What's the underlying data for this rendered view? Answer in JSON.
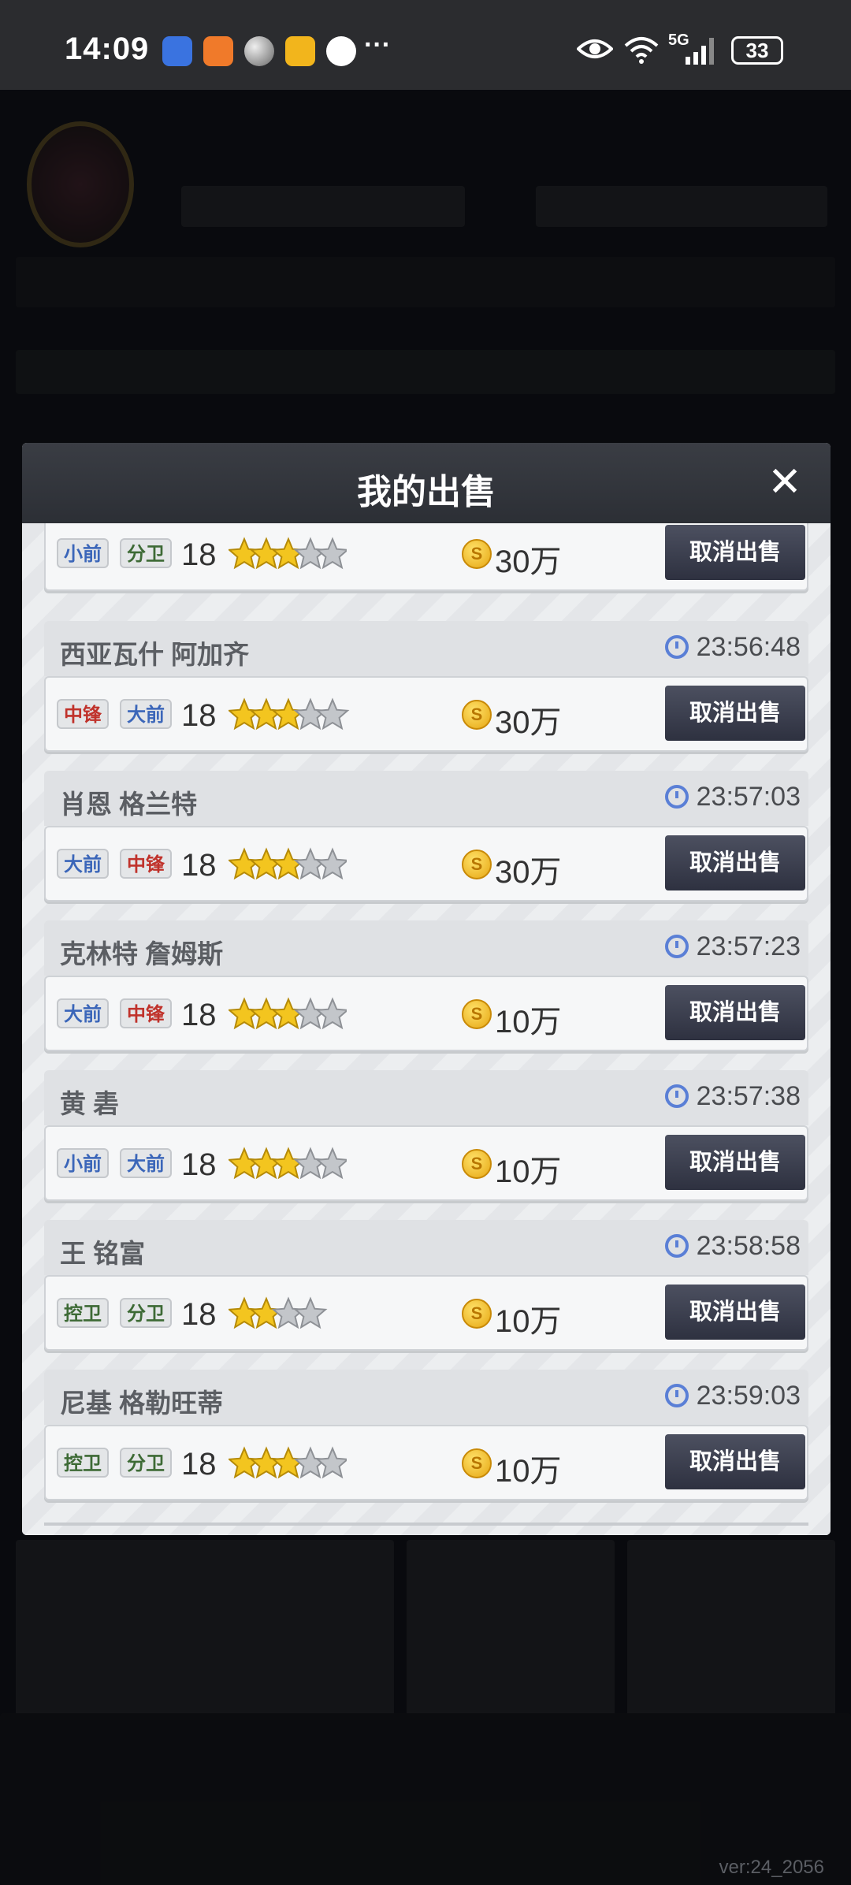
{
  "status_bar": {
    "time": "14:09",
    "more": "···",
    "network": "5G",
    "battery": "33"
  },
  "modal": {
    "title": "我的出售",
    "close_label": "✕"
  },
  "listings": [
    {
      "name": "",
      "timer": "",
      "tags": [
        {
          "label": "小前",
          "color": "blue"
        },
        {
          "label": "分卫",
          "color": "green"
        }
      ],
      "level": "18",
      "stars": 3,
      "half_star": false,
      "price": "30万",
      "cancel_label": "取消出售"
    },
    {
      "name": "西亚瓦什 阿加齐",
      "timer": "23:56:48",
      "tags": [
        {
          "label": "中锋",
          "color": "red"
        },
        {
          "label": "大前",
          "color": "blue"
        }
      ],
      "level": "18",
      "stars": 3,
      "half_star": false,
      "price": "30万",
      "cancel_label": "取消出售"
    },
    {
      "name": "肖恩 格兰特",
      "timer": "23:57:03",
      "tags": [
        {
          "label": "大前",
          "color": "blue"
        },
        {
          "label": "中锋",
          "color": "red"
        }
      ],
      "level": "18",
      "stars": 3,
      "half_star": false,
      "price": "30万",
      "cancel_label": "取消出售"
    },
    {
      "name": "克林特 詹姆斯",
      "timer": "23:57:23",
      "tags": [
        {
          "label": "大前",
          "color": "blue"
        },
        {
          "label": "中锋",
          "color": "red"
        }
      ],
      "level": "18",
      "stars": 3,
      "half_star": false,
      "price": "10万",
      "cancel_label": "取消出售"
    },
    {
      "name": "黄 砉",
      "timer": "23:57:38",
      "tags": [
        {
          "label": "小前",
          "color": "blue"
        },
        {
          "label": "大前",
          "color": "blue"
        }
      ],
      "level": "18",
      "stars": 3,
      "half_star": false,
      "price": "10万",
      "cancel_label": "取消出售"
    },
    {
      "name": "王 铭富",
      "timer": "23:58:58",
      "tags": [
        {
          "label": "控卫",
          "color": "green"
        },
        {
          "label": "分卫",
          "color": "green"
        }
      ],
      "level": "18",
      "stars": 2,
      "half_star": false,
      "price": "10万",
      "cancel_label": "取消出售"
    },
    {
      "name": "尼基 格勒旺蒂",
      "timer": "23:59:03",
      "tags": [
        {
          "label": "控卫",
          "color": "green"
        },
        {
          "label": "分卫",
          "color": "green"
        }
      ],
      "level": "18",
      "stars": 3,
      "half_star": false,
      "price": "10万",
      "cancel_label": "取消出售"
    }
  ],
  "footer": {
    "version": "ver:24_2056"
  }
}
